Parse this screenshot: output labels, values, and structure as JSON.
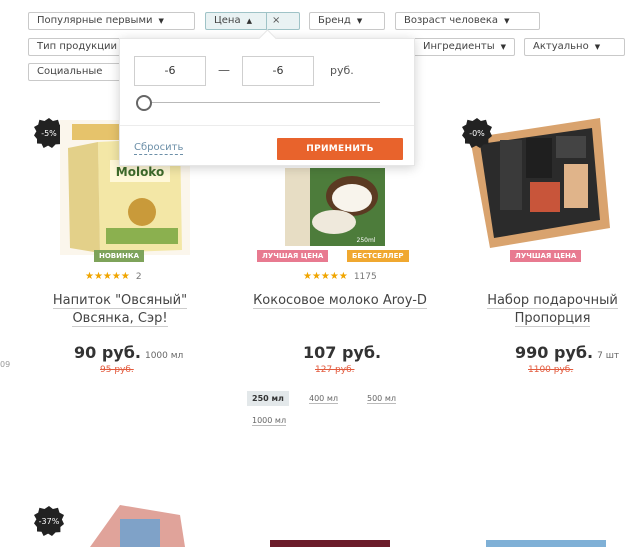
{
  "filters": {
    "row1": [
      {
        "label": "Популярные первыми"
      },
      {
        "label": "Цена"
      },
      {
        "label": "Бренд"
      },
      {
        "label": "Возраст человека"
      }
    ],
    "row2": [
      {
        "label": "Тип продукции"
      },
      {
        "label": "Ингредиенты"
      },
      {
        "label": "Актуально"
      }
    ],
    "row3": [
      {
        "label": "Социальные"
      }
    ],
    "close_glyph": "×"
  },
  "price_popup": {
    "min_value": "-6",
    "max_value": "-6",
    "dash": "—",
    "unit": "руб.",
    "slider_level": 0,
    "reset_label": "Сбросить",
    "apply_label": "ПРИМЕНИТЬ"
  },
  "side_number": "09",
  "products": [
    {
      "discount": "-5%",
      "image_text": "Moloko",
      "tags": [
        {
          "label": "Новинка",
          "color": "#7ea35a"
        }
      ],
      "stars": "★★★★★",
      "reviews": "2",
      "name": "Напиток \"Овсяный\" Овсянка, Сэр!",
      "price": "90 руб.",
      "volume": "1000 мл",
      "old_price": "95 руб."
    },
    {
      "discount": "",
      "image_text": "",
      "tags": [
        {
          "label": "Лучшая цена",
          "color": "#e87a90"
        },
        {
          "label": "Бестселлер",
          "color": "#f0a830"
        }
      ],
      "stars": "★★★★★",
      "reviews": "1175",
      "name": "Кокосовое молоко Aroy-D",
      "price": "107 руб.",
      "volume": "",
      "old_price": "127 руб.",
      "volume_options": [
        "250 мл",
        "400 мл",
        "500 мл",
        "1000 мл"
      ]
    },
    {
      "discount": "-0%",
      "image_text": "",
      "tags": [
        {
          "label": "Лучшая цена",
          "color": "#e87a90"
        }
      ],
      "stars": "",
      "reviews": "",
      "name": "Набор подарочный Пропорция",
      "price": "990 руб.",
      "volume": "7 шт",
      "old_price": "1100 руб."
    }
  ],
  "bottom_row": [
    {
      "discount": "-37%"
    }
  ]
}
